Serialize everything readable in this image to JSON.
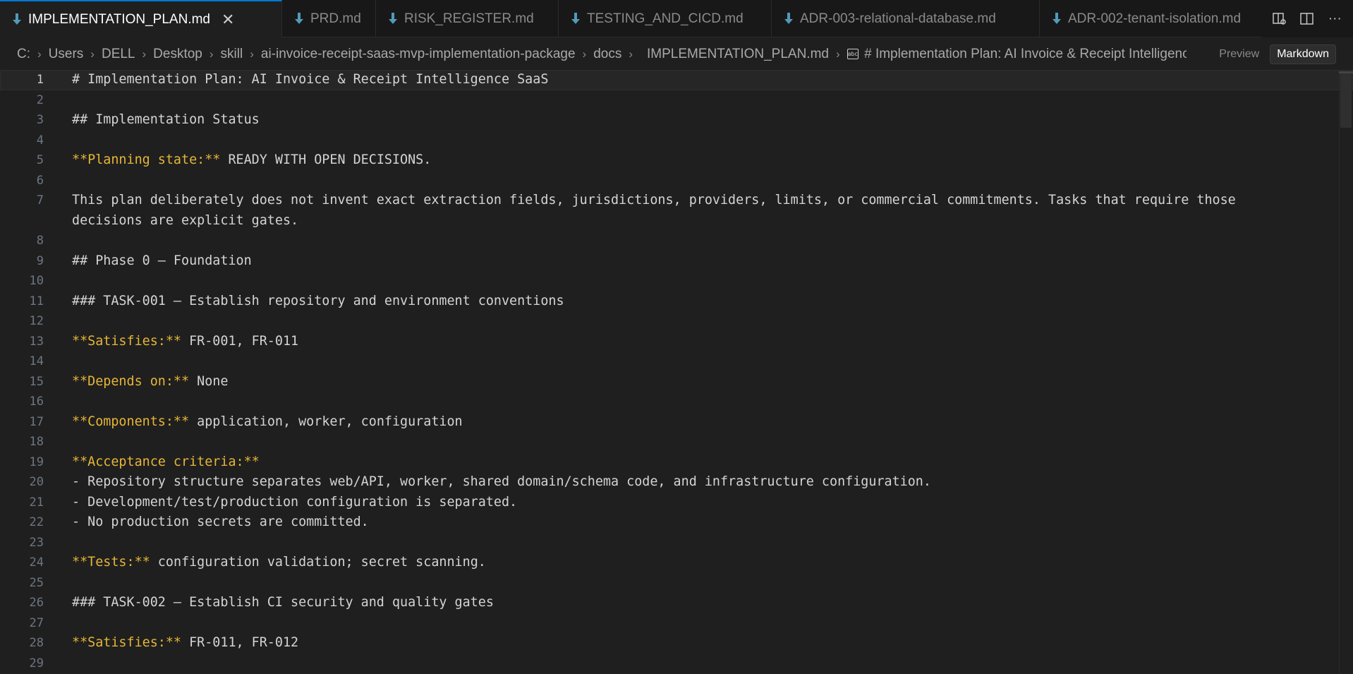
{
  "tabs": [
    {
      "label": "IMPLEMENTATION_PLAN.md",
      "active": true,
      "close": "✕"
    },
    {
      "label": "PRD.md"
    },
    {
      "label": "RISK_REGISTER.md"
    },
    {
      "label": "TESTING_AND_CICD.md"
    },
    {
      "label": "ADR-003-relational-database.md"
    },
    {
      "label": "ADR-002-tenant-isolation.md"
    }
  ],
  "breadcrumb": {
    "parts": [
      "C:",
      "Users",
      "DELL",
      "Desktop",
      "skill",
      "ai-invoice-receipt-saas-mvp-implementation-package",
      "docs"
    ],
    "file": "IMPLEMENTATION_PLAN.md",
    "symbol": "# Implementation Plan: AI Invoice & Receipt Intelligence SaaS",
    "symbol_icon": "abc"
  },
  "view_toggle": {
    "preview": "Preview",
    "markdown": "Markdown"
  },
  "icons": {
    "markdown_file": "download-arrow-icon",
    "split_editor": "split-editor-icon",
    "open_preview": "open-preview-icon",
    "more": "more-icon"
  },
  "colors": {
    "accent": "#0078d4",
    "bold_markup": "#e5b636",
    "md_icon": "#519aba"
  },
  "lines": [
    {
      "n": "1",
      "key": "",
      "text": "# Implementation Plan: AI Invoice & Receipt Intelligence SaaS"
    },
    {
      "n": "2",
      "key": "",
      "text": ""
    },
    {
      "n": "3",
      "key": "",
      "text": "## Implementation Status"
    },
    {
      "n": "4",
      "key": "",
      "text": ""
    },
    {
      "n": "5",
      "key": "**Planning state:**",
      "text": " READY WITH OPEN DECISIONS."
    },
    {
      "n": "6",
      "key": "",
      "text": ""
    },
    {
      "n": "7",
      "key": "",
      "text": "This plan deliberately does not invent exact extraction fields, jurisdictions, providers, limits, or commercial commitments. Tasks that require those decisions are explicit gates."
    },
    {
      "n": "8",
      "key": "",
      "text": ""
    },
    {
      "n": "9",
      "key": "",
      "text": "## Phase 0 — Foundation"
    },
    {
      "n": "10",
      "key": "",
      "text": ""
    },
    {
      "n": "11",
      "key": "",
      "text": "### TASK-001 — Establish repository and environment conventions"
    },
    {
      "n": "12",
      "key": "",
      "text": ""
    },
    {
      "n": "13",
      "key": "**Satisfies:**",
      "text": " FR-001, FR-011"
    },
    {
      "n": "14",
      "key": "",
      "text": ""
    },
    {
      "n": "15",
      "key": "**Depends on:**",
      "text": " None"
    },
    {
      "n": "16",
      "key": "",
      "text": ""
    },
    {
      "n": "17",
      "key": "**Components:**",
      "text": " application, worker, configuration"
    },
    {
      "n": "18",
      "key": "",
      "text": ""
    },
    {
      "n": "19",
      "key": "**Acceptance criteria:**",
      "text": ""
    },
    {
      "n": "20",
      "key": "",
      "text": "- Repository structure separates web/API, worker, shared domain/schema code, and infrastructure configuration."
    },
    {
      "n": "21",
      "key": "",
      "text": "- Development/test/production configuration is separated."
    },
    {
      "n": "22",
      "key": "",
      "text": "- No production secrets are committed."
    },
    {
      "n": "23",
      "key": "",
      "text": ""
    },
    {
      "n": "24",
      "key": "**Tests:**",
      "text": " configuration validation; secret scanning."
    },
    {
      "n": "25",
      "key": "",
      "text": ""
    },
    {
      "n": "26",
      "key": "",
      "text": "### TASK-002 — Establish CI security and quality gates"
    },
    {
      "n": "27",
      "key": "",
      "text": ""
    },
    {
      "n": "28",
      "key": "**Satisfies:**",
      "text": " FR-011, FR-012"
    },
    {
      "n": "29",
      "key": "",
      "text": ""
    }
  ]
}
